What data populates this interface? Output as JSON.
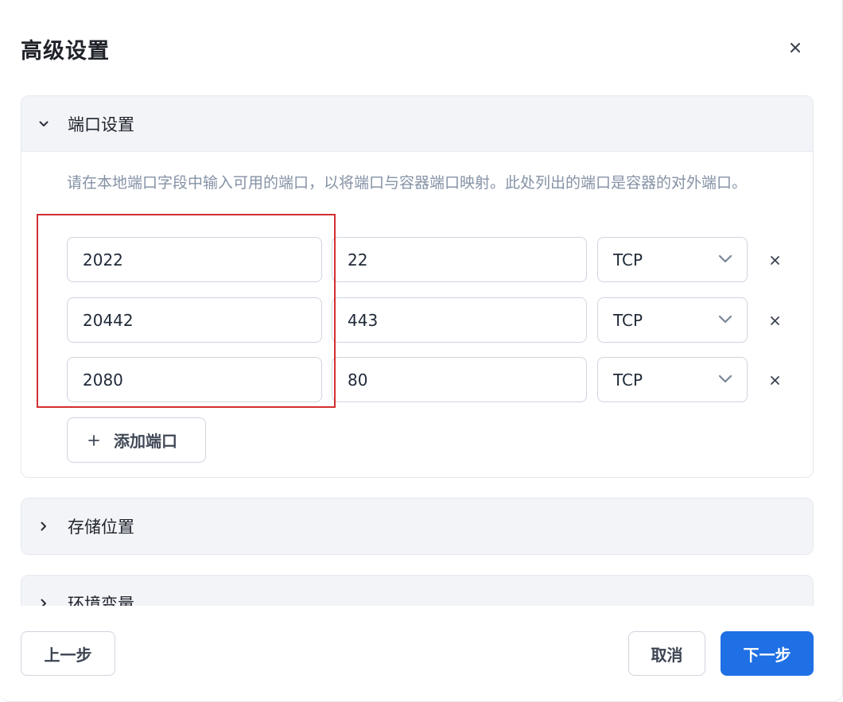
{
  "dialog": {
    "title": "高级设置",
    "close_icon": "close-icon"
  },
  "sections": {
    "ports": {
      "label": "端口设置",
      "expanded": true,
      "description": "请在本地端口字段中输入可用的端口，以将端口与容器端口映射。此处列出的端口是容器的对外端口。",
      "rows": [
        {
          "local_port": "2022",
          "container_port": "22",
          "protocol": "TCP"
        },
        {
          "local_port": "20442",
          "container_port": "443",
          "protocol": "TCP"
        },
        {
          "local_port": "2080",
          "container_port": "80",
          "protocol": "TCP"
        }
      ],
      "add_button_icon": "plus-icon",
      "add_button_label": "添加端口"
    },
    "storage": {
      "label": "存储位置",
      "expanded": false
    },
    "env": {
      "label": "环境变量",
      "expanded": false
    }
  },
  "footer": {
    "back_label": "上一步",
    "cancel_label": "取消",
    "next_label": "下一步"
  },
  "colors": {
    "primary": "#1f6fe5",
    "highlight": "#d32f2f",
    "description_text": "#8592a6",
    "section_header_bg": "#f2f4f8"
  }
}
